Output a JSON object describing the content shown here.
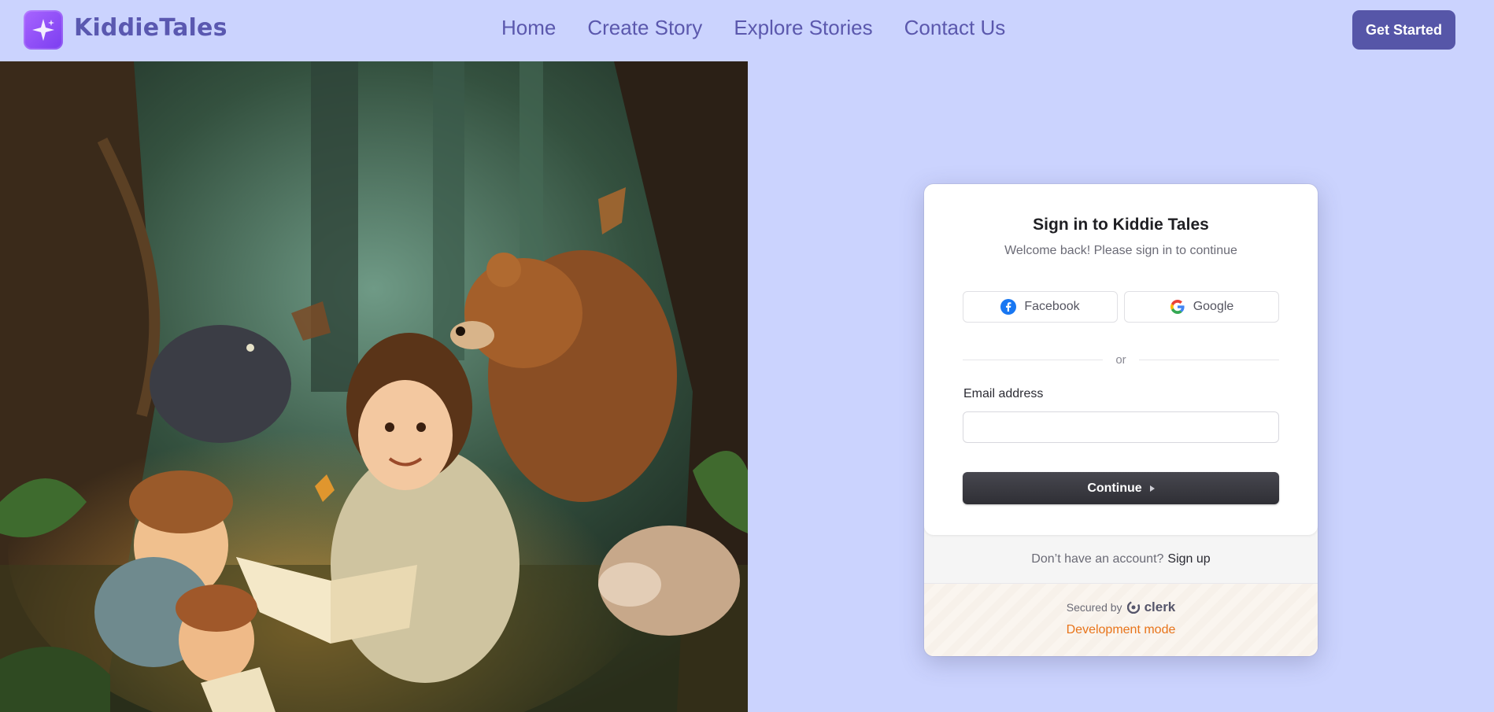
{
  "header": {
    "brand": "KiddieTales",
    "nav": [
      "Home",
      "Create Story",
      "Explore Stories",
      "Contact Us"
    ],
    "cta": "Get Started"
  },
  "card": {
    "title": "Sign in to Kiddie Tales",
    "subtitle": "Welcome back! Please sign in to continue",
    "social": {
      "facebook": "Facebook",
      "google": "Google"
    },
    "divider": "or",
    "email_label": "Email address",
    "email_value": "",
    "continue": "Continue",
    "no_account": "Don’t have an account?",
    "signup": "Sign up",
    "secured_by": "Secured by",
    "clerk": "clerk",
    "dev_mode": "Development mode"
  },
  "colors": {
    "page_bg": "#cbd3fe",
    "brand_text": "#5a58b0",
    "cta_bg": "#5656a8",
    "dev_mode": "#e8741a"
  }
}
